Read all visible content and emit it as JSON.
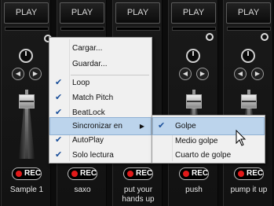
{
  "decks": [
    {
      "play_label": "PLAY",
      "rec_label": "REC",
      "name": "Sample 1"
    },
    {
      "play_label": "PLAY",
      "rec_label": "REC",
      "name": "saxo"
    },
    {
      "play_label": "PLAY",
      "rec_label": "REC",
      "name": "put your hands up"
    },
    {
      "play_label": "PLAY",
      "rec_label": "REC",
      "name": "push"
    },
    {
      "play_label": "PLAY",
      "rec_label": "REC",
      "name": "pump it up"
    }
  ],
  "context_menu": {
    "items": [
      {
        "label": "Cargar...",
        "checked": false
      },
      {
        "label": "Guardar...",
        "checked": false
      },
      {
        "label": "Loop",
        "checked": true
      },
      {
        "label": "Match Pitch",
        "checked": true
      },
      {
        "label": "BeatLock",
        "checked": true
      },
      {
        "label": "Sincronizar en",
        "checked": false,
        "has_submenu": true,
        "highlighted": true
      },
      {
        "label": "AutoPlay",
        "checked": true
      },
      {
        "label": "Solo lectura",
        "checked": true
      }
    ]
  },
  "submenu": {
    "items": [
      {
        "label": "Golpe",
        "checked": true,
        "highlighted": true
      },
      {
        "label": "Medio golpe",
        "checked": false
      },
      {
        "label": "Cuarto de golpe",
        "checked": false
      }
    ]
  },
  "icons": {
    "check": "checkmark-icon",
    "submenu_arrow": "triangle-right-icon",
    "cursor": "mouse-pointer-icon",
    "record": "record-dot-icon"
  },
  "colors": {
    "panel_bg": "#121212",
    "menu_bg": "#f0f0f0",
    "menu_highlight": "#bcd4ec",
    "check_color": "#1a4f9a",
    "rec_dot": "#e11919"
  }
}
